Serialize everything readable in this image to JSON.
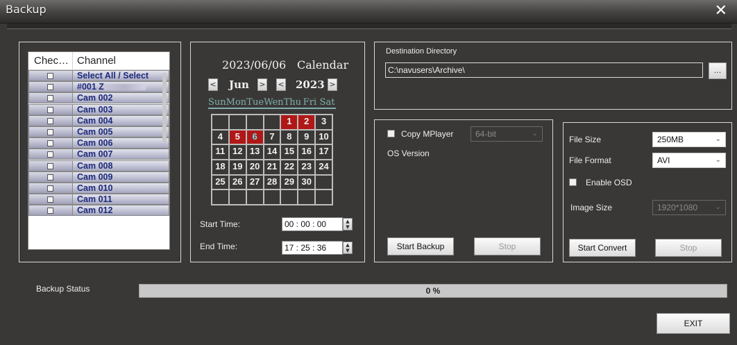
{
  "window": {
    "title": "Backup",
    "close_icon": "close-icon"
  },
  "channels": {
    "header_check": "Chec…",
    "header_channel": "Channel",
    "rows": [
      "Select All / Select",
      "#001 Z",
      "Cam 002",
      "Cam 003",
      "Cam 004",
      "Cam 005",
      "Cam 006",
      "Cam 007",
      "Cam 008",
      "Cam 009",
      "Cam 010",
      "Cam 011",
      "Cam 012"
    ]
  },
  "calendar": {
    "selected_date": "2023/06/06",
    "label": "Calendar",
    "month": "Jun",
    "year": "2023",
    "prev_label": "<",
    "next_label": ">",
    "weekdays": [
      "Sun",
      "Mon",
      "Tue",
      "Wen",
      "Thu",
      "Fri",
      "Sat"
    ],
    "days": [
      "",
      "",
      "",
      "",
      "1",
      "2",
      "3",
      "4",
      "5",
      "6",
      "7",
      "8",
      "9",
      "10",
      "11",
      "12",
      "13",
      "14",
      "15",
      "16",
      "17",
      "18",
      "19",
      "20",
      "21",
      "22",
      "23",
      "24",
      "25",
      "26",
      "27",
      "28",
      "29",
      "30",
      "",
      "",
      "",
      "",
      "",
      "",
      "",
      ""
    ],
    "highlighted_days": [
      "1",
      "2",
      "5",
      "6"
    ]
  },
  "time": {
    "start_label": "Start Time:",
    "start_value": "00 : 00 : 00",
    "end_label": "End Time:",
    "end_value": "17 : 25 : 36"
  },
  "destination": {
    "label": "Destination Directory",
    "path": "C:\\navusers\\Archive\\",
    "browse_label": "..."
  },
  "backup": {
    "copy_mplayer_label": "Copy MPlayer",
    "bitness_value": "64-bit",
    "os_version_label": "OS Version",
    "start_label": "Start Backup",
    "stop_label": "Stop"
  },
  "convert": {
    "file_size_label": "File Size",
    "file_size_value": "250MB",
    "file_format_label": "File Format",
    "file_format_value": "AVI",
    "enable_osd_label": "Enable OSD",
    "image_size_label": "Image Size",
    "image_size_value": "1920*1080",
    "start_label": "Start Convert",
    "stop_label": "Stop"
  },
  "status": {
    "label": "Backup Status",
    "progress_text": "0 %",
    "progress_fraction": 0
  },
  "exit_label": "EXIT",
  "colors": {
    "highlight": "#b01818",
    "today_text": "#6fe0e0",
    "channel_text": "#1d2a7a"
  }
}
